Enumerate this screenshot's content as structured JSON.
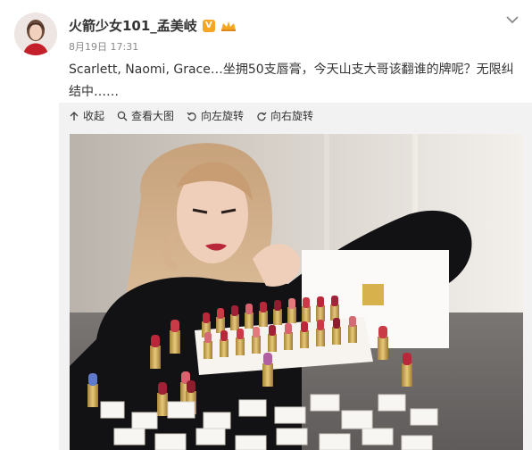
{
  "post": {
    "username": "火箭少女101_孟美岐",
    "verified_badge": "V",
    "date": "8月19日 17:31",
    "text": "Scarlett, Naomi, Grace…坐拥50支唇膏，今天山支大哥该翻谁的牌呢？无限纠结中……"
  },
  "media": {
    "actions": [
      {
        "icon": "collapse-icon",
        "label": "收起"
      },
      {
        "icon": "magnify-icon",
        "label": "查看大图"
      },
      {
        "icon": "rotate-left-icon",
        "label": "向左旋转"
      },
      {
        "icon": "rotate-right-icon",
        "label": "向右旋转"
      }
    ]
  },
  "colors": {
    "accent_orange": "#f5a623",
    "lipstick_red": "#b8283a",
    "gold": "#c9a24c"
  }
}
